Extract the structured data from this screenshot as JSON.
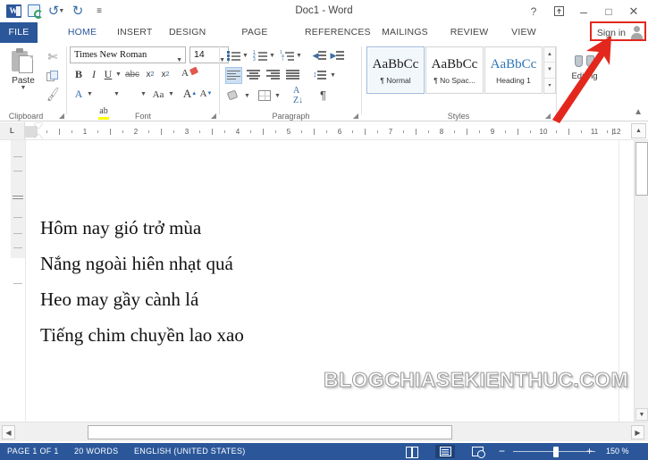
{
  "titlebar": {
    "document_title": "Doc1 - Word",
    "qat": [
      {
        "name": "word-logo-icon",
        "label": "Word"
      },
      {
        "name": "save-icon",
        "label": "Save"
      },
      {
        "name": "undo-icon",
        "label": "Undo"
      },
      {
        "name": "redo-icon",
        "label": "Redo"
      },
      {
        "name": "customize-qat-icon",
        "label": "Customize Quick Access Toolbar"
      }
    ],
    "window_controls": [
      {
        "name": "help-button",
        "glyph": "?"
      },
      {
        "name": "ribbon-display-options-button",
        "glyph": "⤒"
      },
      {
        "name": "minimize-button",
        "glyph": "–"
      },
      {
        "name": "maximize-button",
        "glyph": "□"
      },
      {
        "name": "close-button",
        "glyph": "✕"
      }
    ]
  },
  "tabs": {
    "file_label": "FILE",
    "items": [
      {
        "label": "HOME",
        "active": true
      },
      {
        "label": "INSERT",
        "active": false
      },
      {
        "label": "DESIGN",
        "active": false
      },
      {
        "label": "PAGE LAYOUT",
        "active": false
      },
      {
        "label": "REFERENCES",
        "active": false
      },
      {
        "label": "MAILINGS",
        "active": false
      },
      {
        "label": "REVIEW",
        "active": false
      },
      {
        "label": "VIEW",
        "active": false
      }
    ],
    "sign_in_label": "Sign in"
  },
  "ribbon": {
    "clipboard": {
      "group_label": "Clipboard",
      "paste_label": "Paste",
      "cut_label": "Cut",
      "copy_label": "Copy",
      "format_painter_label": "Format Painter"
    },
    "font": {
      "group_label": "Font",
      "font_name": "Times New Roman",
      "font_size": "14",
      "bold_label": "B",
      "italic_label": "I",
      "underline_label": "U",
      "strikethrough_label": "abc",
      "subscript_label": "x",
      "superscript_label": "x",
      "change_case_label": "Aa",
      "grow_font_label": "A",
      "shrink_font_label": "A",
      "text_effects_label": "A",
      "highlight_label": "ab",
      "font_color_label": "A",
      "font_color_hex": "#cc0000",
      "highlight_color_hex": "#ffff00",
      "clear_formatting_label": "Clear All Formatting"
    },
    "paragraph": {
      "group_label": "Paragraph",
      "bullets_label": "Bullets",
      "numbering_label": "Numbering",
      "multilevel_label": "Multilevel List",
      "decrease_indent_label": "Decrease Indent",
      "increase_indent_label": "Increase Indent",
      "align_left_label": "Align Left",
      "align_center_label": "Center",
      "align_right_label": "Align Right",
      "justify_label": "Justify",
      "line_spacing_label": "Line and Paragraph Spacing",
      "shading_label": "Shading",
      "borders_label": "Borders",
      "sort_label": "Sort",
      "show_marks_label": "¶",
      "active_alignment": "Align Left"
    },
    "styles": {
      "group_label": "Styles",
      "items": [
        {
          "preview": "AaBbCc",
          "name": "¶ Normal",
          "selected": true,
          "heading": false
        },
        {
          "preview": "AaBbCc",
          "name": "¶ No Spac...",
          "selected": false,
          "heading": false
        },
        {
          "preview": "AaBbCc",
          "name": "Heading 1",
          "selected": false,
          "heading": true
        }
      ]
    },
    "editing": {
      "group_label": "Editing",
      "find_label": "Find"
    },
    "collapse_ribbon_label": "Collapse the Ribbon"
  },
  "ruler": {
    "tab_selector_label": "L",
    "ticks": [
      "1",
      "2",
      "3",
      "4",
      "5",
      "6",
      "7",
      "8",
      "9",
      "10",
      "11",
      "12"
    ]
  },
  "document": {
    "lines": [
      "Hôm nay gió trở mùa",
      "Nắng ngoài hiên nhạt quá",
      "Heo may gầy cành lá",
      "Tiếng chim chuyền lao xao"
    ],
    "watermark": "BLOGCHIASEKIENTHUC.COM"
  },
  "statusbar": {
    "page_info": "PAGE 1 OF 1",
    "word_count": "20 WORDS",
    "language": "ENGLISH (UNITED STATES)",
    "view_buttons": [
      {
        "name": "read-mode-button",
        "label": "Read Mode"
      },
      {
        "name": "print-layout-button",
        "label": "Print Layout",
        "active": true
      },
      {
        "name": "web-layout-button",
        "label": "Web Layout"
      }
    ],
    "zoom_out_label": "−",
    "zoom_in_label": "+",
    "zoom_level": "150 %"
  },
  "annotation": {
    "highlight_color": "#e3271d",
    "target_label": "Sign in"
  }
}
